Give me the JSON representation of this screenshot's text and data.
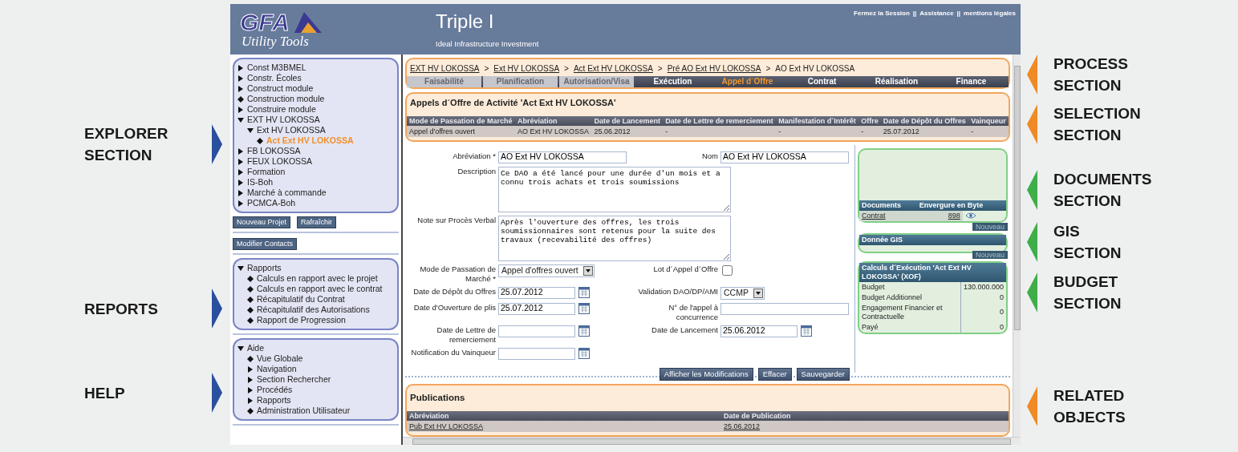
{
  "callouts_left": [
    {
      "text": "EXPLORER SECTION",
      "color": "#2a4f9e"
    },
    {
      "text": "REPORTS",
      "color": "#2a4f9e"
    },
    {
      "text": "HELP",
      "color": "#2a4f9e"
    }
  ],
  "callouts_right": [
    {
      "text": "PROCESS SECTION",
      "color": "#f08a24"
    },
    {
      "text": "SELECTION SECTION",
      "color": "#f08a24"
    },
    {
      "text": "DOCUMENTS SECTION",
      "color": "#3fae49"
    },
    {
      "text": "GIS SECTION",
      "color": "#3fae49"
    },
    {
      "text": "BUDGET SECTION",
      "color": "#3fae49"
    },
    {
      "text": "RELATED OBJECTS",
      "color": "#f08a24"
    }
  ],
  "header": {
    "logo_text": "GFA",
    "logo_subtitle": "Utility Tools",
    "title": "Triple I",
    "subtitle": "Ideal Infrastructure Investment",
    "link_separator": "||",
    "links": [
      "Fermez la Session",
      "Assistance",
      "mentions légales"
    ]
  },
  "explorer": [
    {
      "label": "Const M3BMEL",
      "kind": "branch",
      "expanded": false,
      "selected": false
    },
    {
      "label": "Constr. Écoles",
      "kind": "branch",
      "expanded": false,
      "selected": false
    },
    {
      "label": "Construct module",
      "kind": "branch",
      "expanded": false,
      "selected": false
    },
    {
      "label": "Construction module",
      "kind": "leaf",
      "selected": false
    },
    {
      "label": "Construire module",
      "kind": "branch",
      "expanded": false,
      "selected": false
    },
    {
      "label": "EXT HV LOKOSSA",
      "kind": "branch",
      "expanded": true,
      "selected": false,
      "children": [
        {
          "label": "Ext HV LOKOSSA",
          "kind": "branch",
          "expanded": true,
          "selected": false,
          "children": [
            {
              "label": "Act Ext HV LOKOSSA",
              "kind": "leaf",
              "selected": true
            }
          ]
        }
      ]
    },
    {
      "label": "FB LOKOSSA",
      "kind": "branch",
      "expanded": false,
      "selected": false
    },
    {
      "label": "FEUX LOKOSSA",
      "kind": "branch",
      "expanded": false,
      "selected": false
    },
    {
      "label": "Formation",
      "kind": "branch",
      "expanded": false,
      "selected": false
    },
    {
      "label": "IS-Boh",
      "kind": "branch",
      "expanded": false,
      "selected": false
    },
    {
      "label": "Marché à commande",
      "kind": "branch",
      "expanded": false,
      "selected": false
    },
    {
      "label": "PCMCA-Boh",
      "kind": "branch",
      "expanded": false,
      "selected": false
    }
  ],
  "explorer_buttons": [
    "Nouveau Projet",
    "Rafraîchir"
  ],
  "contacts_button": "Modifier Contacts",
  "reports": {
    "label": "Rapports",
    "kind": "branch",
    "expanded": true,
    "children": [
      {
        "label": "Calculs en rapport avec le projet",
        "kind": "leaf"
      },
      {
        "label": "Calculs en rapport avec le contrat",
        "kind": "leaf"
      },
      {
        "label": "Récapitulatif du Contrat",
        "kind": "leaf"
      },
      {
        "label": "Récapitulatif des Autorisations",
        "kind": "leaf"
      },
      {
        "label": "Rapport de Progression",
        "kind": "leaf"
      }
    ]
  },
  "help": {
    "label": "Aide",
    "kind": "branch",
    "expanded": true,
    "children": [
      {
        "label": "Vue Globale",
        "kind": "leaf"
      },
      {
        "label": "Navigation",
        "kind": "branch",
        "expanded": false
      },
      {
        "label": "Section Rechercher",
        "kind": "branch",
        "expanded": false
      },
      {
        "label": "Procédés",
        "kind": "branch",
        "expanded": false
      },
      {
        "label": "Rapports",
        "kind": "branch",
        "expanded": false
      },
      {
        "label": "Administration Utilisateur",
        "kind": "leaf"
      }
    ]
  },
  "breadcrumb": {
    "separator": ">",
    "links": [
      "EXT HV LOKOSSA",
      "Ext HV LOKOSSA",
      "Act Ext HV LOKOSSA",
      "Pré AO Ext HV LOKOSSA"
    ],
    "current": "AO Ext HV LOKOSSA"
  },
  "process_tabs": [
    {
      "label": "Faisabilité",
      "disabled": true,
      "selected": false
    },
    {
      "label": "Planification",
      "disabled": true,
      "selected": false
    },
    {
      "label": "Autorisation/Visa",
      "disabled": true,
      "selected": false
    },
    {
      "label": "Exécution",
      "disabled": false,
      "selected": false
    },
    {
      "label": "Appel d´Offre",
      "disabled": false,
      "selected": true
    },
    {
      "label": "Contrat",
      "disabled": false,
      "selected": false
    },
    {
      "label": "Réalisation",
      "disabled": false,
      "selected": false
    },
    {
      "label": "Finance",
      "disabled": false,
      "selected": false
    }
  ],
  "selection": {
    "title": "Appels d´Offre de Activité 'Act Ext HV LOKOSSA'",
    "columns": [
      "Mode de Passation de Marché",
      "Abréviation",
      "Date de Lancement",
      "Date de Lettre de remerciement",
      "Manifestation d´Intérêt",
      "Offre",
      "Date de Dépôt du Offres",
      "Vainqueur"
    ],
    "rows": [
      [
        "Appel d'offres ouvert",
        "AO Ext HV LOKOSSA",
        "25.06.2012",
        "-",
        "-",
        "-",
        "25.07.2012",
        "-"
      ]
    ]
  },
  "form": {
    "rows": [
      {
        "fields": [
          {
            "kind": "text",
            "label": "Abréviation *",
            "value": "AO Ext HV LOKOSSA"
          },
          {
            "kind": "text",
            "label": "Nom",
            "value": "AO Ext HV LOKOSSA"
          }
        ]
      },
      {
        "fields": [
          {
            "kind": "textarea",
            "label": "Description",
            "value": "Ce DAO a été lancé pour une durée d'un mois et a connu trois achats et trois soumissions"
          }
        ]
      },
      {
        "fields": [
          {
            "kind": "textarea",
            "label": "Note sur Procès Verbal",
            "value": "Après l'ouverture des offres, les trois soumissionnaires sont retenus pour la suite des travaux (recevabilité des offres)"
          }
        ]
      },
      {
        "fields": [
          {
            "kind": "select",
            "label": "Mode de Passation de Marché *",
            "value": "Appel d'offres ouvert"
          },
          {
            "kind": "checkbox",
            "label": "Lot d´Appel d´Offre",
            "checked": false
          }
        ]
      },
      {
        "fields": [
          {
            "kind": "date",
            "label": "Date de Dépôt du Offres",
            "value": "25.07.2012"
          },
          {
            "kind": "select",
            "label": "Validation DAO/DP/AMI",
            "value": "CCMP"
          }
        ]
      },
      {
        "fields": [
          {
            "kind": "date",
            "label": "Date d'Ouverture de plis",
            "value": "25.07.2012"
          },
          {
            "kind": "text",
            "label": "N° de l'appel à concurrence"
          }
        ]
      },
      {
        "fields": [
          {
            "kind": "date",
            "label": "Date de Lettre de remerciement"
          },
          {
            "kind": "date",
            "label": "Date de Lancement",
            "value": "25.06.2012"
          }
        ]
      },
      {
        "fields": [
          {
            "kind": "date",
            "label": "Notification du Vainqueur"
          }
        ]
      }
    ],
    "buttons": [
      "Afficher les Modifications",
      "Effacer",
      "Sauvegarder"
    ]
  },
  "documents": {
    "columns": [
      "Documents",
      "Envergure en Byte"
    ],
    "rows": [
      {
        "name": "Contrat",
        "size": "898"
      }
    ],
    "button": "Nouveau"
  },
  "gis": {
    "title": "Donnée GIS",
    "button": "Nouveau"
  },
  "budget": {
    "title": "Calculs d´Exécution 'Act Ext HV LOKOSSA' (XOF)",
    "rows": [
      {
        "label": "Budget",
        "value": "130.000.000"
      },
      {
        "label": "Budget Additionnel",
        "value": "0"
      },
      {
        "label": "Engagement Financier et Contractuelle",
        "value": "0"
      },
      {
        "label": "Payé",
        "value": "0"
      }
    ]
  },
  "publications": {
    "title": "Publications",
    "columns": [
      "Abréviation",
      "Date de Publication"
    ],
    "rows": [
      [
        "Pub Ext HV LOKOSSA",
        "25.06.2012"
      ]
    ]
  }
}
